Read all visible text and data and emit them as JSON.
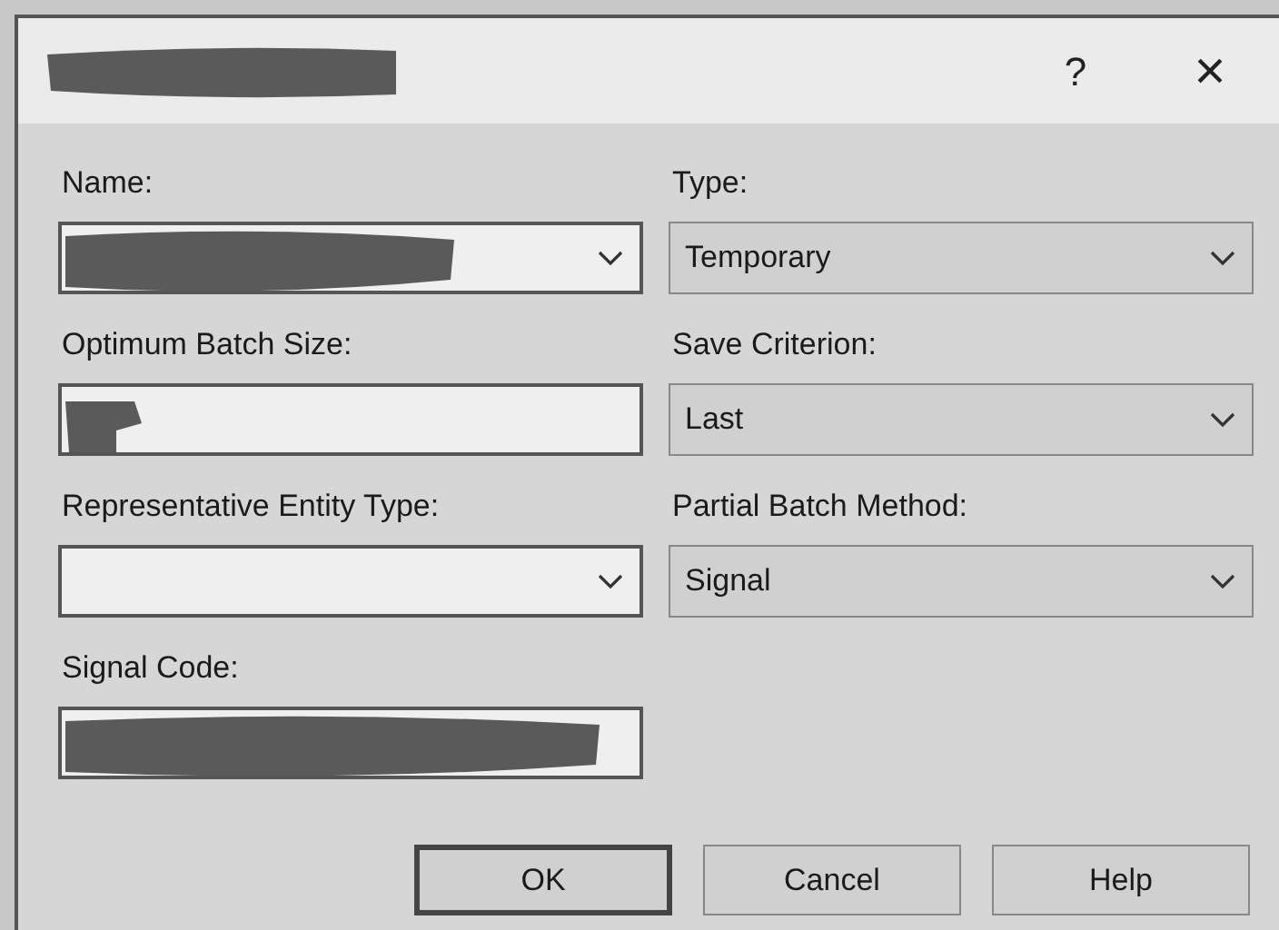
{
  "window": {
    "title_redacted": true,
    "help_button": "?",
    "close_button": "×"
  },
  "fields": [
    {
      "label": "Name:",
      "kind": "combo",
      "value_redacted": true
    },
    {
      "label": "Type:",
      "kind": "dropdown",
      "value": "Temporary"
    },
    {
      "label": "Optimum Batch Size:",
      "kind": "text",
      "value_redacted": true
    },
    {
      "label": "Save Criterion:",
      "kind": "dropdown",
      "value": "Last"
    },
    {
      "label": "Representative Entity Type:",
      "kind": "combo"
    },
    {
      "label": "Partial Batch Method:",
      "kind": "dropdown",
      "value": "Signal"
    },
    {
      "label": "Signal Code:",
      "kind": "text",
      "value_redacted": true
    }
  ],
  "buttons": [
    {
      "label": "OK",
      "default": true
    },
    {
      "label": "Cancel",
      "default": false
    },
    {
      "label": "Help",
      "default": false
    }
  ]
}
